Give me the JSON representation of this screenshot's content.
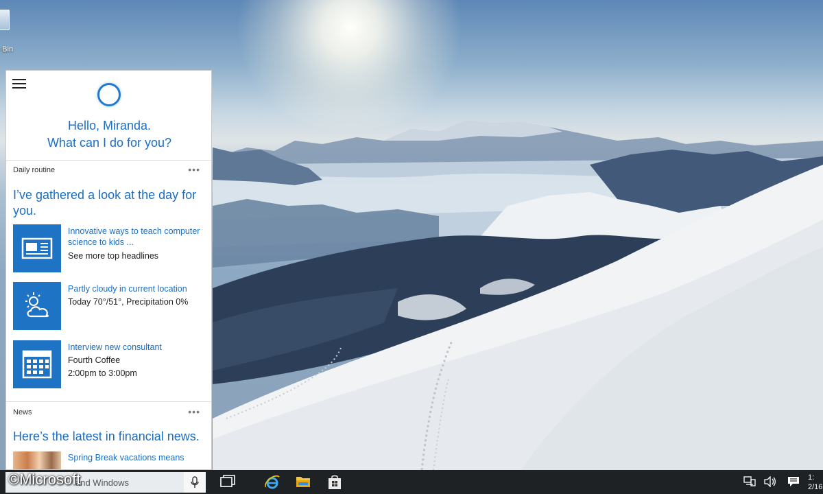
{
  "desktop": {
    "icons": [
      {
        "label": "e Bin",
        "icon": "recycle-bin-icon"
      }
    ]
  },
  "cortana": {
    "greeting_line1": "Hello, Miranda.",
    "greeting_line2": "What can I do for you?",
    "sections": {
      "daily": {
        "label": "Daily routine",
        "more": "•••",
        "headline": "I’ve gathered a look at the day for you.",
        "cards": [
          {
            "icon": "news-icon",
            "line1": "Innovative ways to teach computer science to kids ...",
            "line2": "See more top headlines"
          },
          {
            "icon": "partly-cloudy-icon",
            "line1": "Partly cloudy in current location",
            "line2": "Today 70°/51°, Precipitation 0%"
          },
          {
            "icon": "calendar-icon",
            "line1": "Interview new consultant",
            "line2": "Fourth Coffee",
            "line3": "2:00pm to 3:00pm"
          }
        ]
      },
      "news": {
        "label": "News",
        "more": "•••",
        "headline": "Here’s the latest in financial news.",
        "item_title": "Spring Break vacations means"
      }
    }
  },
  "taskbar": {
    "search_placeholder": "and Windows",
    "clock_time": "1:",
    "clock_date": "2/16"
  },
  "watermark": "©Microsoft",
  "colors": {
    "accent": "#1e73c4",
    "link_text": "#1b6ec2",
    "taskbar": "#1f2225"
  }
}
